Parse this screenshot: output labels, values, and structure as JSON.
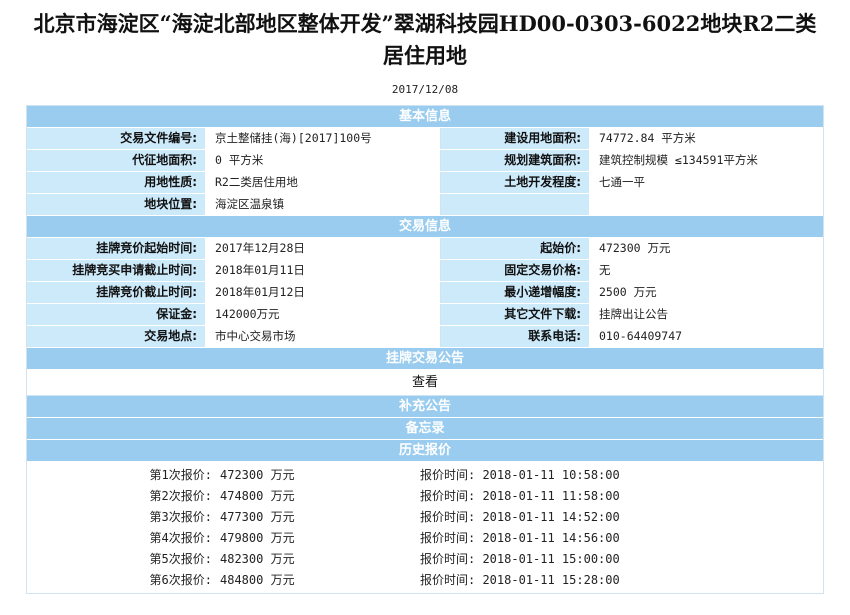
{
  "page": {
    "title_line1": "北京市海淀区“海淀北部地区整体开发”翠湖科技园HD00-0303-6022地块R2二类",
    "title_line2": "居住用地",
    "date": "2017/12/08"
  },
  "sections": {
    "basic": "基本信息",
    "trade": "交易信息",
    "listing_notice": "挂牌交易公告",
    "supplement": "补充公告",
    "memo": "备忘录",
    "history": "历史报价"
  },
  "basic": [
    {
      "l1": "交易文件编号:",
      "v1": "京土整储挂(海)[2017]100号",
      "l2": "建设用地面积:",
      "v2": "74772.84 平方米"
    },
    {
      "l1": "代征地面积:",
      "v1": "0 平方米",
      "l2": "规划建筑面积:",
      "v2": "建筑控制规模 ≤134591平方米"
    },
    {
      "l1": "用地性质:",
      "v1": "R2二类居住用地",
      "l2": "土地开发程度:",
      "v2": "七通一平"
    },
    {
      "l1": "地块位置:",
      "v1": "海淀区温泉镇",
      "l2": "",
      "v2": ""
    }
  ],
  "trade": [
    {
      "l1": "挂牌竞价起始时间:",
      "v1": "2017年12月28日",
      "l2": "起始价:",
      "v2": "472300 万元"
    },
    {
      "l1": "挂牌竞买申请截止时间:",
      "v1": "2018年01月11日",
      "l2": "固定交易价格:",
      "v2": "无"
    },
    {
      "l1": "挂牌竞价截止时间:",
      "v1": "2018年01月12日",
      "l2": "最小递增幅度:",
      "v2": "2500 万元"
    },
    {
      "l1": "保证金:",
      "v1": "142000万元",
      "l2": "其它文件下载:",
      "v2": "挂牌出让公告"
    },
    {
      "l1": "交易地点:",
      "v1": "市中心交易市场",
      "l2": "联系电话:",
      "v2": "010-64409747"
    }
  ],
  "view_link": "查看",
  "bids": [
    {
      "no": "第1次报价:",
      "amt": "472300 万元",
      "time": "报价时间: 2018-01-11 10:58:00"
    },
    {
      "no": "第2次报价:",
      "amt": "474800 万元",
      "time": "报价时间: 2018-01-11 11:58:00"
    },
    {
      "no": "第3次报价:",
      "amt": "477300 万元",
      "time": "报价时间: 2018-01-11 14:52:00"
    },
    {
      "no": "第4次报价:",
      "amt": "479800 万元",
      "time": "报价时间: 2018-01-11 14:56:00"
    },
    {
      "no": "第5次报价:",
      "amt": "482300 万元",
      "time": "报价时间: 2018-01-11 15:00:00"
    },
    {
      "no": "第6次报价:",
      "amt": "484800 万元",
      "time": "报价时间: 2018-01-11 15:28:00"
    }
  ]
}
